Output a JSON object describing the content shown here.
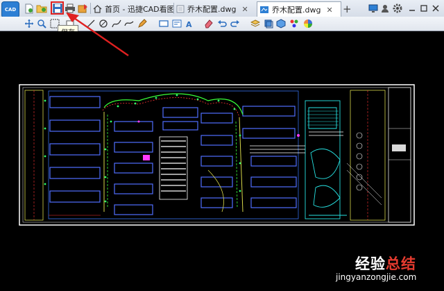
{
  "tabs": [
    {
      "label": "首页 - 迅捷CAD看图"
    },
    {
      "label": "乔木配置.dwg"
    },
    {
      "label": "乔木配置.dwg"
    }
  ],
  "tooltip": "保存",
  "watermark": {
    "part1": "经验",
    "part2": "总结",
    "url": "jingyanzongjie.com"
  },
  "app_logo_text": "CAD",
  "new_tab_symbol": "+",
  "close_symbol": "✕"
}
